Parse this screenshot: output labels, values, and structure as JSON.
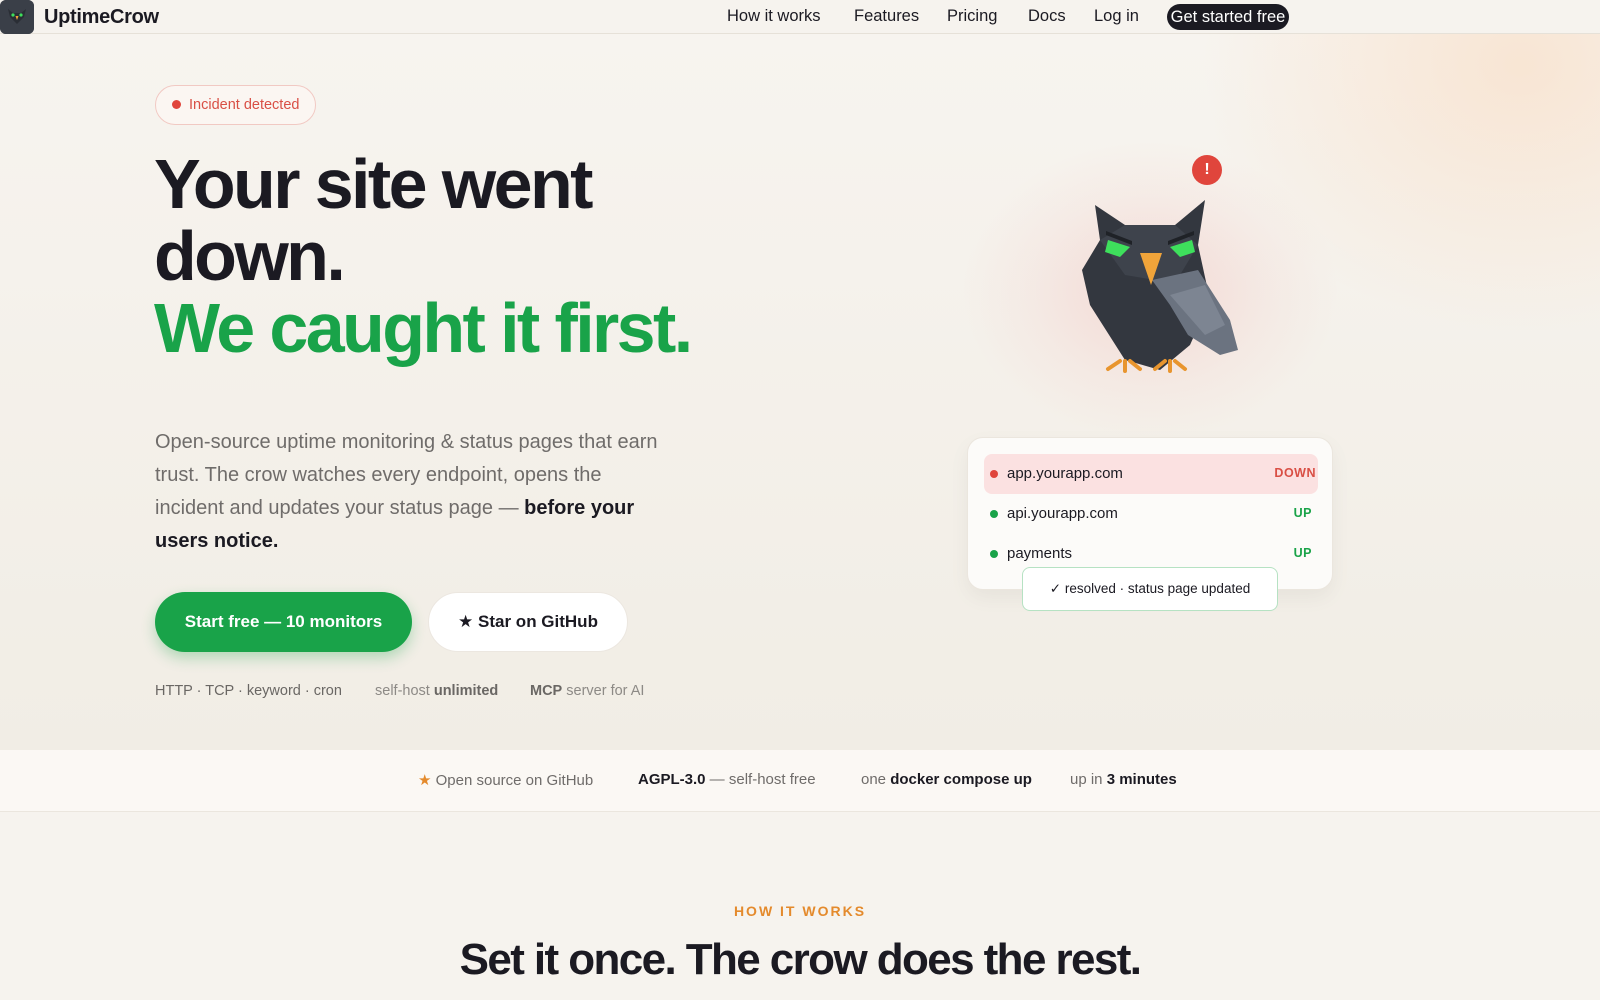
{
  "brand": {
    "name": "UptimeCrow",
    "logo_icon": "crow-icon"
  },
  "nav": {
    "links": [
      {
        "label": "How it works"
      },
      {
        "label": "Features"
      },
      {
        "label": "Pricing"
      },
      {
        "label": "Docs"
      },
      {
        "label": "Log in"
      }
    ],
    "cta_label": "Get started free"
  },
  "hero": {
    "badge": "Incident detected",
    "headline_line1": "Your site went",
    "headline_line2": "down.",
    "headline_line3": "We caught it first.",
    "lead_text": "Open-source uptime monitoring & status pages that earn trust. The crow watches every endpoint, opens the incident and updates your status page — ",
    "lead_bold": "before your users notice.",
    "primary_button": "Start free — 10 monitors",
    "secondary_button_icon": "star-icon",
    "secondary_button": "★ Star on GitHub",
    "features": [
      {
        "bold": "HTTP · TCP · keyword · cron",
        "normal": ""
      },
      {
        "normal": "self-host ",
        "bold": "unlimited"
      },
      {
        "bold": "MCP",
        "normal": " server for AI"
      }
    ],
    "alert_badge": "!"
  },
  "status_card": {
    "rows": [
      {
        "host": "app.yourapp.com",
        "state": "DOWN",
        "color": "#e0453c"
      },
      {
        "host": "api.yourapp.com",
        "state": "UP",
        "color": "#19a349"
      },
      {
        "host": "payments",
        "state": "UP",
        "color": "#19a349"
      }
    ],
    "resolved_text": "✓ resolved · status page updated"
  },
  "strip": {
    "item1_icon": "star-icon",
    "item1": "Open source on GitHub",
    "item2_bold": "AGPL-3.0",
    "item2_rest": " — self-host free",
    "item3_pre": "one ",
    "item3_bold": "docker compose up",
    "item4_pre": "up in ",
    "item4_bold": "3 minutes"
  },
  "how_it_works": {
    "kicker": "HOW IT WORKS",
    "title": "Set it once. The crow does the rest."
  },
  "colors": {
    "accent_green": "#19a349",
    "alert_red": "#e0453c",
    "kicker_orange": "#e48a2c",
    "ink": "#1b1a22"
  }
}
